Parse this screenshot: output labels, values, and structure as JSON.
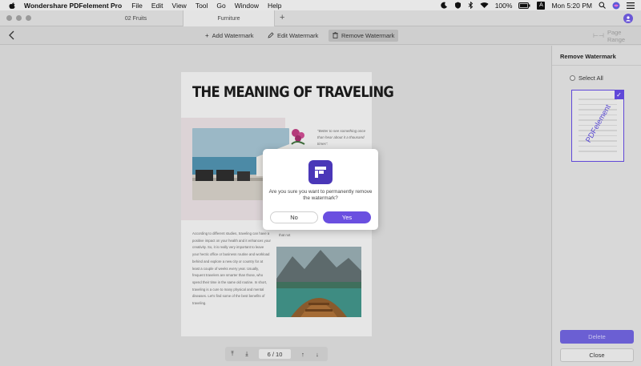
{
  "menubar": {
    "app_name": "Wondershare PDFelement Pro",
    "items": [
      "File",
      "Edit",
      "View",
      "Tool",
      "Go",
      "Window",
      "Help"
    ],
    "battery": "100%",
    "input_source": "A",
    "clock": "Mon 5:20 PM"
  },
  "tabs": [
    {
      "label": "02 Fruits"
    },
    {
      "label": "Furniture"
    }
  ],
  "toolbar": {
    "add_watermark": "Add Watermark",
    "edit_watermark": "Edit Watermark",
    "remove_watermark": "Remove Watermark",
    "page_range": "Page Range"
  },
  "document": {
    "title": "THE MEANING OF TRAVELING",
    "quote": "\"Better to see something once than hear about it a thousand times\".",
    "paragraph": "According to different studies, traveling can have a positive impact on your health and it enhances your creativity. So, it is really very important to leave your hectic office or business routine and workload behind and explore a new city or country for at least a couple of weeks every year. Usually, frequent travelers are smarter than those, who spend their time in the same old routine. In short, traveling is a cure to many physical and mental diseases. Let's find some of the best benefits of traveling.",
    "that_not": "that not"
  },
  "pagenav": {
    "current": "6",
    "separator": "/",
    "total": "10"
  },
  "panel": {
    "title": "Remove Watermark",
    "select_all": "Select All",
    "thumb_watermark": "PDFelement",
    "delete_label": "Delete",
    "close_label": "Close"
  },
  "dialog": {
    "message": "Are you sure you want to permanently remove the watermark?",
    "no_label": "No",
    "yes_label": "Yes"
  },
  "colors": {
    "accent": "#6a4fe0",
    "app_icon": "#4a37b8"
  }
}
